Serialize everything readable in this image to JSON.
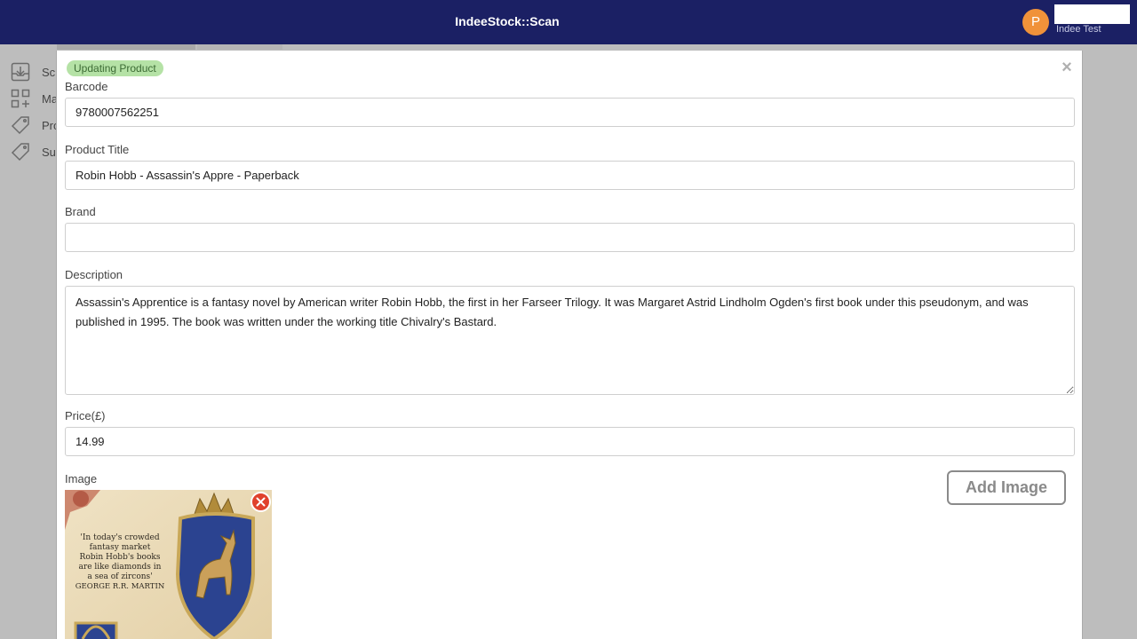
{
  "header": {
    "app_title": "IndeeStock::Scan",
    "avatar_initial": "P",
    "user_name": "Indee Test"
  },
  "sidebar": {
    "items": [
      {
        "label": "Sc",
        "icon": "download-tray-icon"
      },
      {
        "label": "Ma",
        "icon": "grid-add-icon"
      },
      {
        "label": "Pro",
        "icon": "tag-icon"
      },
      {
        "label": "Su",
        "icon": "tag-icon"
      }
    ]
  },
  "modal": {
    "status_badge": "Updating Product",
    "close_icon": "close-icon",
    "fields": {
      "barcode_label": "Barcode",
      "barcode_value": "9780007562251",
      "title_label": "Product Title",
      "title_value": "Robin Hobb - Assassin's Appre - Paperback",
      "brand_label": "Brand",
      "brand_value": "",
      "description_label": "Description",
      "description_value": "Assassin's Apprentice is a fantasy novel by American writer Robin Hobb, the first in her Farseer Trilogy. It was Margaret Astrid Lindholm Ogden's first book under this pseudonym, and was published in 1995. The book was written under the working title Chivalry's Bastard.",
      "price_label": "Price(£)",
      "price_value": "14.99",
      "image_label": "Image"
    },
    "add_image_label": "Add Image",
    "book_cover": {
      "quote": [
        "'In today's crowded",
        "fantasy market",
        "Robin Hobb's books",
        "are like diamonds in",
        "a sea of zircons'"
      ],
      "quote_author": "GEORGE R.R. MARTIN"
    }
  },
  "colors": {
    "topbar": "#1b2064",
    "avatar": "#f0923a",
    "badge_bg": "#b5e2a6",
    "remove_button": "#e0412c"
  }
}
